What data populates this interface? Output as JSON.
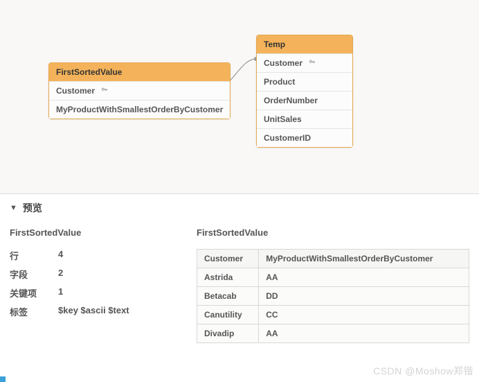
{
  "diagram": {
    "tables": [
      {
        "name": "FirstSortedValue",
        "fields": [
          {
            "label": "Customer",
            "is_key": true
          },
          {
            "label": "MyProductWithSmallestOrderByCustomer",
            "is_key": false
          }
        ]
      },
      {
        "name": "Temp",
        "fields": [
          {
            "label": "Customer",
            "is_key": true
          },
          {
            "label": "Product",
            "is_key": false
          },
          {
            "label": "OrderNumber",
            "is_key": false
          },
          {
            "label": "UnitSales",
            "is_key": false
          },
          {
            "label": "CustomerID",
            "is_key": false
          }
        ]
      }
    ]
  },
  "preview": {
    "title": "预览",
    "left": {
      "title": "FirstSortedValue",
      "stats": [
        {
          "label": "行",
          "value": "4"
        },
        {
          "label": "字段",
          "value": "2"
        },
        {
          "label": "关键项",
          "value": "1"
        },
        {
          "label": "标签",
          "value": "$key $ascii $text"
        }
      ]
    },
    "right": {
      "title": "FirstSortedValue",
      "columns": [
        "Customer",
        "MyProductWithSmallestOrderByCustomer"
      ],
      "rows": [
        [
          "Astrida",
          "AA"
        ],
        [
          "Betacab",
          "DD"
        ],
        [
          "Canutility",
          "CC"
        ],
        [
          "Divadip",
          "AA"
        ]
      ]
    }
  },
  "watermark": "CSDN @Moshow郑锴"
}
